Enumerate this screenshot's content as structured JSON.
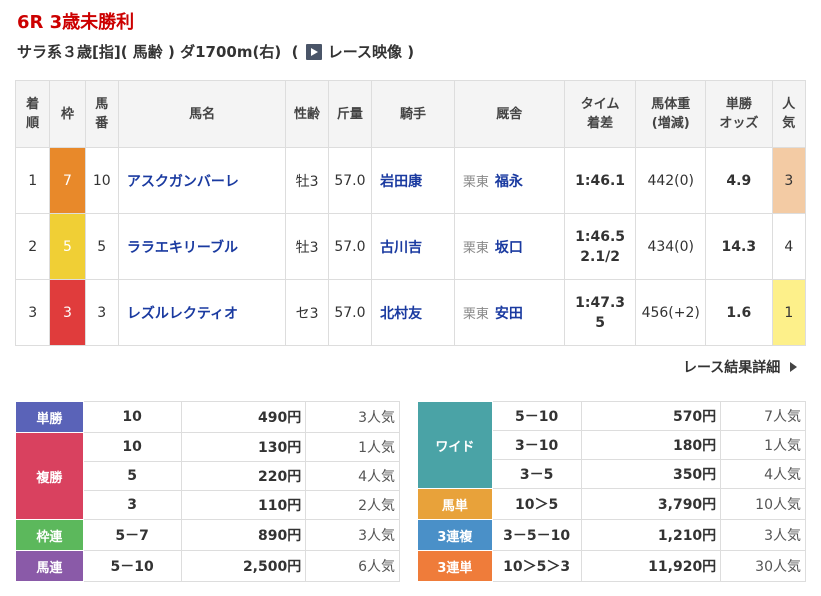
{
  "header": {
    "title": "6R 3歳未勝利",
    "subtitle": "サラ系３歳[指]( 馬齢 ) ダ1700m(右)  ( ",
    "video_label": "レース映像",
    "subtitle_end": " )"
  },
  "result_table": {
    "headers": {
      "rank": "着\n順",
      "waku": "枠",
      "umaban": "馬\n番",
      "name": "馬名",
      "sexage": "性齢",
      "weight": "斤量",
      "jockey": "騎手",
      "stable": "厩舎",
      "time": "タイム\n着差",
      "body": "馬体重\n(増減)",
      "odds": "単勝\nオッズ",
      "pop": "人\n気"
    },
    "rows": [
      {
        "rank": "1",
        "waku": "7",
        "umaban": "10",
        "name": "アスクガンバーレ",
        "sexage": "牡3",
        "weight": "57.0",
        "jockey": "岩田康",
        "loc": "栗東",
        "trainer": "福永",
        "time": "1:46.1",
        "body": "442(0)",
        "odds": "4.9",
        "pop": "3"
      },
      {
        "rank": "2",
        "waku": "5",
        "umaban": "5",
        "name": "ララエキリーブル",
        "sexage": "牡3",
        "weight": "57.0",
        "jockey": "古川吉",
        "loc": "栗東",
        "trainer": "坂口",
        "time": "1:46.5\n2.1/2",
        "body": "434(0)",
        "odds": "14.3",
        "pop": "4"
      },
      {
        "rank": "3",
        "waku": "3",
        "umaban": "3",
        "name": "レズルレクティオ",
        "sexage": "セ3",
        "weight": "57.0",
        "jockey": "北村友",
        "loc": "栗東",
        "trainer": "安田",
        "time": "1:47.3\n5",
        "body": "456(+2)",
        "odds": "1.6",
        "pop": "1"
      }
    ]
  },
  "detail_link": "レース結果詳細",
  "payouts_left": {
    "win": {
      "label": "単勝",
      "color": "#5a63b8",
      "combo": "10",
      "amount": "490円",
      "pop": "3人気"
    },
    "place": {
      "label": "複勝",
      "color": "#d9415f",
      "rows": [
        {
          "combo": "10",
          "amount": "130円",
          "pop": "1人気"
        },
        {
          "combo": "5",
          "amount": "220円",
          "pop": "4人気"
        },
        {
          "combo": "3",
          "amount": "110円",
          "pop": "2人気"
        }
      ]
    },
    "bracket": {
      "label": "枠連",
      "color": "#5cb85c",
      "combo": "5－7",
      "amount": "890円",
      "pop": "3人気"
    },
    "quinella": {
      "label": "馬連",
      "color": "#8a5aa8",
      "combo": "5－10",
      "amount": "2,500円",
      "pop": "6人気"
    }
  },
  "payouts_right": {
    "wide": {
      "label": "ワイド",
      "color": "#4aa3a6",
      "rows": [
        {
          "combo": "5－10",
          "amount": "570円",
          "pop": "7人気"
        },
        {
          "combo": "3－10",
          "amount": "180円",
          "pop": "1人気"
        },
        {
          "combo": "3－5",
          "amount": "350円",
          "pop": "4人気"
        }
      ]
    },
    "exacta": {
      "label": "馬単",
      "color": "#e8a23a",
      "combo": "10＞5",
      "amount": "3,790円",
      "pop": "10人気"
    },
    "trio": {
      "label": "3連複",
      "color": "#4a90c8",
      "combo": "3－5－10",
      "amount": "1,210円",
      "pop": "3人気"
    },
    "trifecta": {
      "label": "3連単",
      "color": "#ef7c3a",
      "combo": "10＞5＞3",
      "amount": "11,920円",
      "pop": "30人気"
    }
  }
}
